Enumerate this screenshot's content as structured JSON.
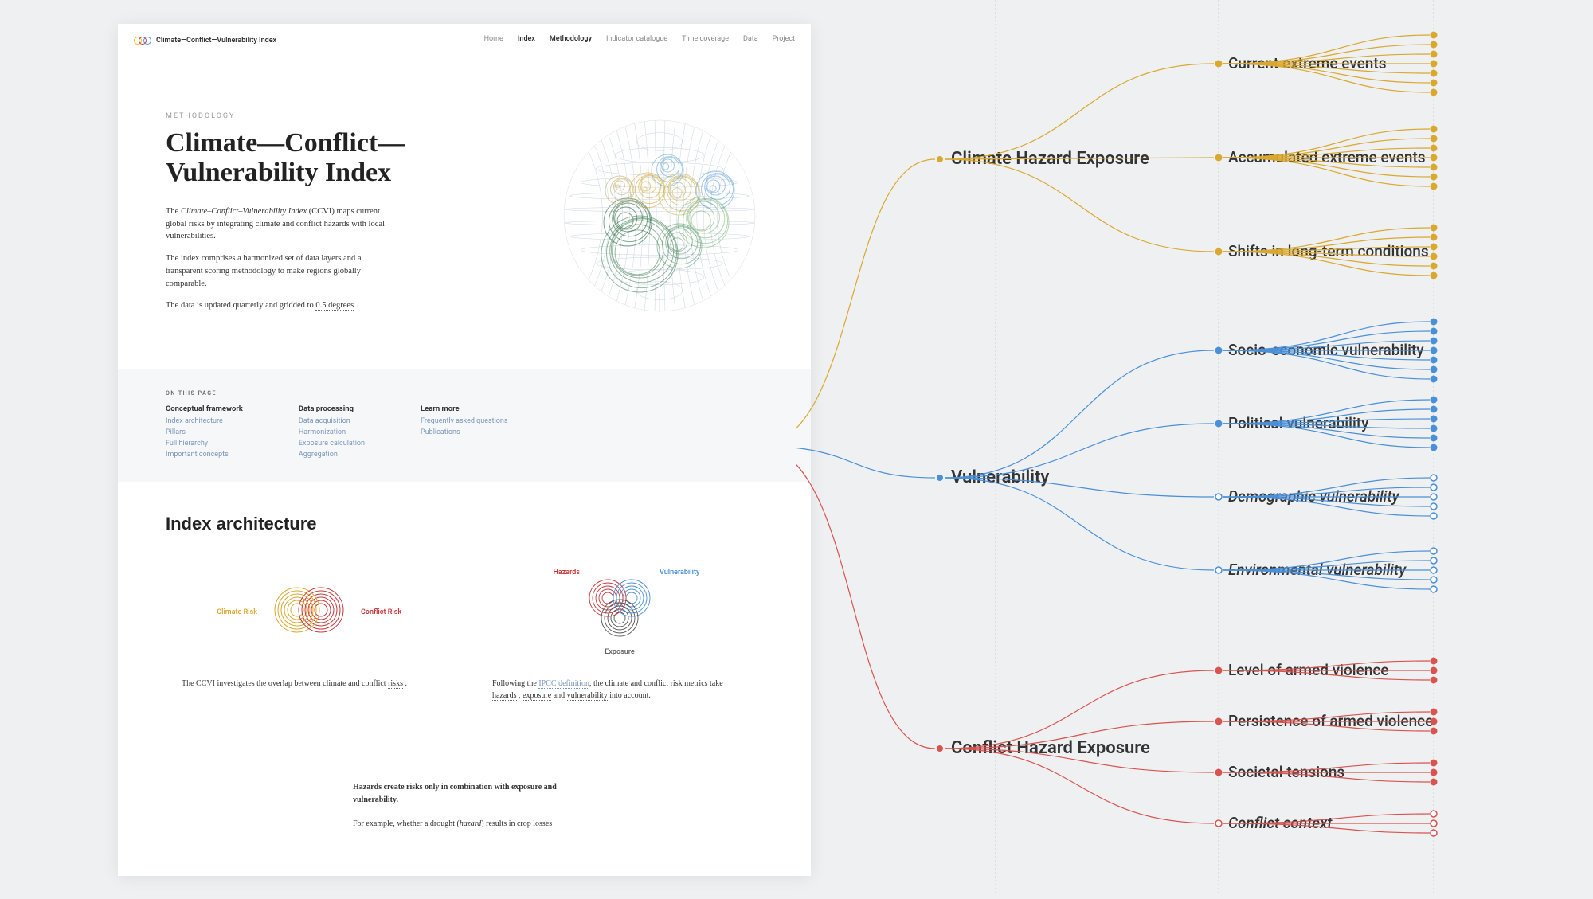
{
  "brand": "Climate—Conflict—Vulnerability Index",
  "nav": {
    "home": "Home",
    "index": "Index",
    "methodology": "Methodology",
    "catalogue": "Indicator catalogue",
    "time": "Time coverage",
    "data": "Data",
    "project": "Project"
  },
  "hero": {
    "eyebrow": "METHODOLOGY",
    "title": "Climate—Conflict—Vulnerability Index",
    "p1a": "The ",
    "p1b": "Climate–Conflict–Vulnerability Index",
    "p1c": " (CCVI) maps current global risks by integrating climate and conflict hazards with local vulnerabilities.",
    "p2": "The index comprises a harmonized set of data layers and a transparent scoring methodology to make regions globally comparable.",
    "p3a": "The data is updated quarterly and gridded to ",
    "p3b": "0.5 degrees",
    "p3c": " ."
  },
  "toc": {
    "label": "ON THIS PAGE",
    "cols": [
      {
        "h": "Conceptual framework",
        "items": [
          "Index architecture",
          "Pillars",
          "Full hierarchy",
          "Important concepts"
        ]
      },
      {
        "h": "Data processing",
        "items": [
          "Data acquisition",
          "Harmonization",
          "Exposure calculation",
          "Aggregation"
        ]
      },
      {
        "h": "Learn more",
        "items": [
          "Frequently asked questions",
          "Publications"
        ]
      }
    ]
  },
  "arch": {
    "title": "Index architecture",
    "venn1": {
      "left": "Climate Risk",
      "right": "Conflict Risk"
    },
    "venn2": {
      "tl": "Hazards",
      "tr": "Vulnerability",
      "b": "Exposure"
    },
    "p1a": "The CCVI investigates the overlap between climate and conflict ",
    "p1b": "risks",
    "p1c": " .",
    "p2a": "Following the ",
    "p2b": "IPCC definition",
    "p2c": ", the climate and conflict risk metrics take ",
    "p2d": "hazards",
    "p2e": " , ",
    "p2f": "exposure",
    "p2g": " and ",
    "p2h": "vulnerability",
    "p2i": " into account."
  },
  "below": {
    "p1": "Hazards create risks only in combination with exposure and vulnerability.",
    "p2a": "For example, whether a drought (",
    "p2b": "hazard",
    "p2c": ") results in crop losses"
  },
  "tree": {
    "pillars": [
      {
        "name": "Climate Hazard Exposure",
        "color": "yel",
        "dims": [
          {
            "name": "Current extreme events",
            "n": 7,
            "style": "solid"
          },
          {
            "name": "Accumulated extreme events",
            "n": 7,
            "style": "solid"
          },
          {
            "name": "Shifts in long-term conditions",
            "n": 6,
            "style": "solid"
          }
        ]
      },
      {
        "name": "Vulnerability",
        "color": "blu",
        "dims": [
          {
            "name": "Socio-economic vulnerability",
            "n": 7,
            "style": "solid"
          },
          {
            "name": "Political vulnerability",
            "n": 6,
            "style": "solid"
          },
          {
            "name": "Demographic vulnerability",
            "n": 5,
            "style": "open"
          },
          {
            "name": "Environmental vulnerability",
            "n": 5,
            "style": "open"
          }
        ]
      },
      {
        "name": "Conflict Hazard Exposure",
        "color": "red",
        "dims": [
          {
            "name": "Level of armed violence",
            "n": 3,
            "style": "solid"
          },
          {
            "name": "Persistence of armed violence",
            "n": 3,
            "style": "solid"
          },
          {
            "name": "Societal tensions",
            "n": 3,
            "style": "solid"
          },
          {
            "name": "Conflict context",
            "n": 3,
            "style": "open"
          }
        ]
      }
    ]
  }
}
